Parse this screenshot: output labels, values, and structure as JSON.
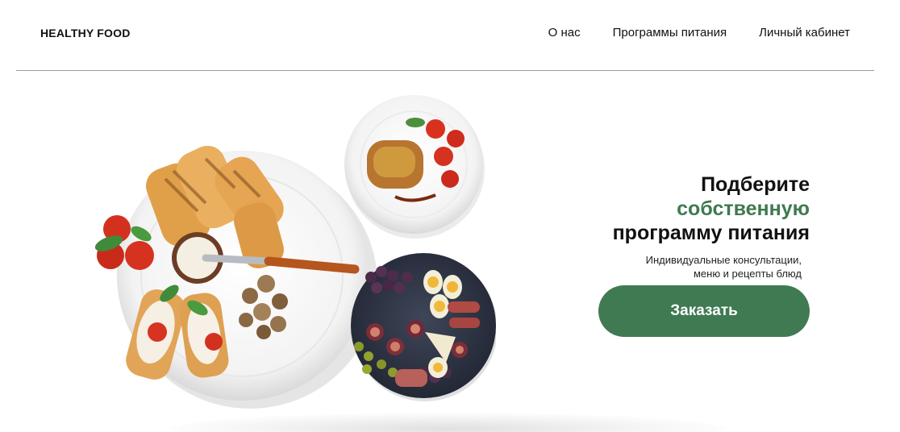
{
  "header": {
    "logo": "HEALTHY FOOD",
    "nav": [
      {
        "label": "О нас"
      },
      {
        "label": "Программы питания"
      },
      {
        "label": "Личный кабинет"
      }
    ]
  },
  "hero": {
    "title_line1": "Подберите",
    "title_accent": "собственную",
    "title_line3": "программу питания",
    "subtitle_line1": "Индивидуальные консультации,",
    "subtitle_line2": "меню и рецепты блюд",
    "cta_label": "Заказать"
  },
  "colors": {
    "accent": "#3f7a4f",
    "button": "#3f7a52",
    "text": "#111111",
    "divider": "#9a9a9a"
  }
}
